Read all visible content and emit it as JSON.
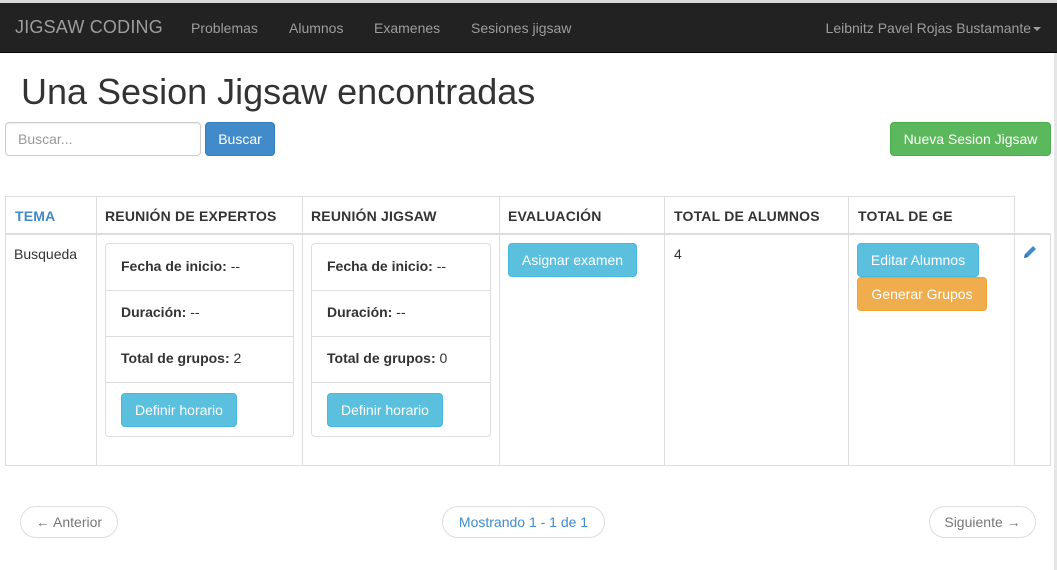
{
  "navbar": {
    "brand": "JIGSAW CODING",
    "links": [
      "Problemas",
      "Alumnos",
      "Examenes",
      "Sesiones jigsaw"
    ],
    "user": "Leibnitz Pavel Rojas Bustamante"
  },
  "page": {
    "title": "Una Sesion Jigsaw encontradas"
  },
  "search": {
    "placeholder": "Buscar...",
    "value": "",
    "button_label": "Buscar"
  },
  "actions": {
    "new_session_label": "Nueva Sesion Jigsaw"
  },
  "table": {
    "headers": [
      "TEMA",
      "REUNIÓN DE EXPERTOS",
      "REUNIÓN JIGSAW",
      "EVALUACIÓN",
      "TOTAL DE ALUMNOS",
      "TOTAL DE GE"
    ],
    "rows": [
      {
        "tema": "Busqueda",
        "expertos": {
          "fecha_label": "Fecha de inicio:",
          "fecha_value": "--",
          "duracion_label": "Duración:",
          "duracion_value": "--",
          "grupos_label": "Total de grupos:",
          "grupos_value": "2",
          "button_label": "Definir horario"
        },
        "jigsaw": {
          "fecha_label": "Fecha de inicio:",
          "fecha_value": "--",
          "duracion_label": "Duración:",
          "duracion_value": "--",
          "grupos_label": "Total de grupos:",
          "grupos_value": "0",
          "button_label": "Definir horario"
        },
        "evaluacion_button": "Asignar examen",
        "total_alumnos": "4",
        "ge_buttons": [
          "Editar Alumnos",
          "Generar Grupos"
        ],
        "edit_icon": "pencil-icon"
      }
    ]
  },
  "pagination": {
    "prev_label": "← Anterior",
    "info": "Mostrando 1 - 1 de 1",
    "next_label": "Siguiente →"
  },
  "colors": {
    "navbar": "#222222",
    "primary": "#428bca",
    "success": "#5cb85c",
    "info": "#5bc0de",
    "warning": "#f0ad4e"
  }
}
